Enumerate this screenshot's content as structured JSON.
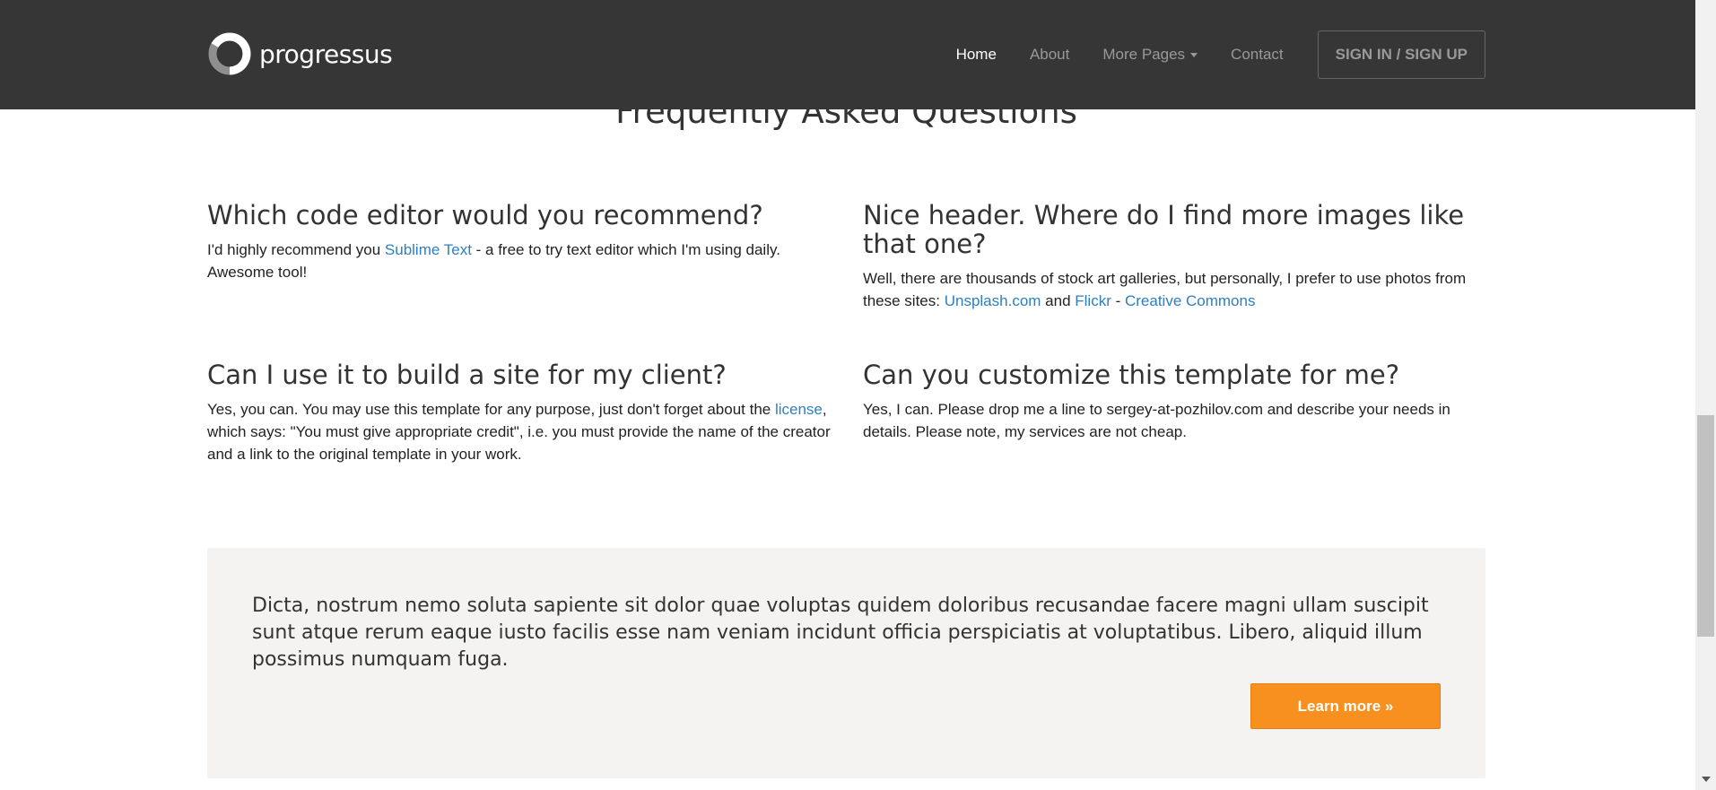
{
  "nav": {
    "brand": "progressus",
    "items": [
      "Home",
      "About",
      "More Pages",
      "Contact"
    ],
    "signin": "SIGN IN / SIGN UP"
  },
  "faq": {
    "title": "Frequently Asked Questions",
    "q1": {
      "question": "Which code editor would you recommend?",
      "a_pre": "I'd highly recommend you ",
      "a_link": "Sublime Text",
      "a_post": " - a free to try text editor which I'm using daily. Awesome tool!"
    },
    "q2": {
      "question": "Nice header. Where do I find more images like that one?",
      "a_pre": "Well, there are thousands of stock art galleries, but personally, I prefer to use photos from these sites: ",
      "link1": "Unsplash.com",
      "mid": " and ",
      "link2": "Flickr",
      "dash": " - ",
      "link3": "Creative Commons"
    },
    "q3": {
      "question": "Can I use it to build a site for my client?",
      "a_pre": "Yes, you can. You may use this template for any purpose, just don't forget about the ",
      "a_link": "license",
      "a_post": ", which says: \"You must give appropriate credit\", i.e. you must provide the name of the creator and a link to the original template in your work."
    },
    "q4": {
      "question": "Can you customize this template for me?",
      "answer": "Yes, I can. Please drop me a line to sergey-at-pozhilov.com and describe your needs in details. Please note, my services are not cheap."
    }
  },
  "jumbotron": {
    "text": "Dicta, nostrum nemo soluta sapiente sit dolor quae voluptas quidem doloribus recusandae facere magni ullam suscipit sunt atque rerum eaque iusto facilis esse nam veniam incidunt officia perspiciatis at voluptatibus. Libero, aliquid illum possimus numquam fuga.",
    "button": "Learn more »"
  },
  "colors": {
    "navbar": "#363636",
    "link": "#2e7fc2",
    "accent": "#f7901e",
    "panel": "#f4f3f1"
  }
}
